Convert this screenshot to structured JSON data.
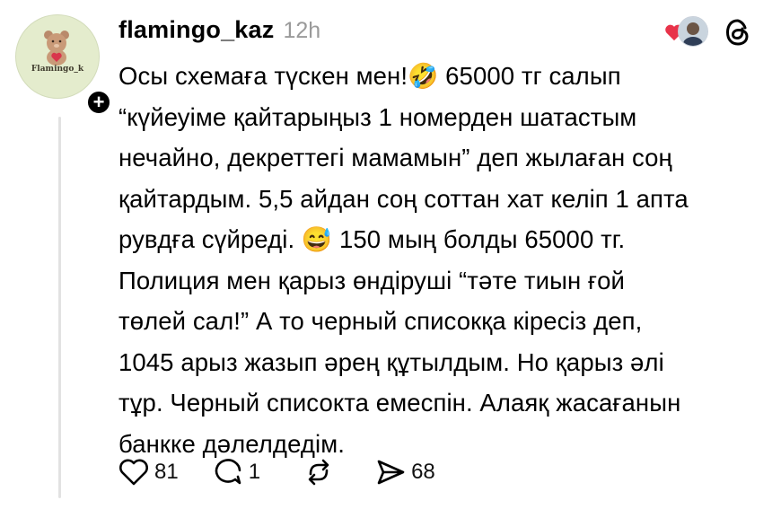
{
  "post": {
    "author": {
      "username": "flamingo_kaz",
      "avatar_text": "Flamingo_k"
    },
    "time": "12h",
    "text": "Осы схемаға түскен мен!🤣 65000 тг салып\n“күйеуіме қайтарыңыз 1 номерден шатастым\nнечайно, декреттегі мамамын” деп жылаған соң\nқайтардым. 5,5 айдан соң соттан хат келіп 1 апта\nрувдға сүйреді. 😅 150 мың болды 65000 тг.\nПолиция мен қарыз өндіруші “тәте тиын ғой\nтөлей сал!” А то черный списокқа кіресіз деп,\n1045 арыз жазып әрең құтылдым. Но қарыз әлі\nтұр. Черный списокта емеспін. Алаяқ жасағанын\nбанкке дәлелдедім.",
    "likes": "81",
    "replies": "1",
    "shares": "68"
  },
  "icons": {
    "follow": "+",
    "heart_reaction": "heart-icon",
    "threads_logo": "threads-logo-icon",
    "like": "heart-outline-icon",
    "reply": "speech-bubble-icon",
    "repost": "repost-icon",
    "share": "paper-plane-icon"
  },
  "colors": {
    "heart": "#e8334a",
    "muted_text": "#9a9a9a",
    "avatar_bg": "#e4eccd"
  }
}
